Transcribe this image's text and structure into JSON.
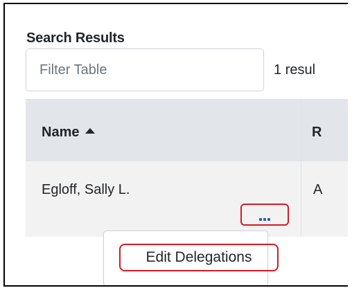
{
  "section": {
    "title": "Search Results"
  },
  "filter": {
    "placeholder": "Filter Table",
    "value": ""
  },
  "results": {
    "count_text": "1 resul"
  },
  "table": {
    "columns": [
      {
        "label": "Name",
        "sort": "ascending",
        "sort_icon": "caret-up-icon"
      },
      {
        "label": "R"
      }
    ],
    "rows": [
      {
        "name": "Egloff, Sally L.",
        "next": "A"
      }
    ]
  },
  "row_actions": {
    "icon": "ellipsis-icon",
    "highlight_color": "#d71920",
    "icon_color": "#2b5ea8"
  },
  "menu": {
    "items": [
      {
        "label": "Edit Delegations"
      }
    ]
  },
  "colors": {
    "header_bg": "#e2e6ea",
    "row_bg": "#f2f2f2",
    "annotation": "#d71920"
  }
}
